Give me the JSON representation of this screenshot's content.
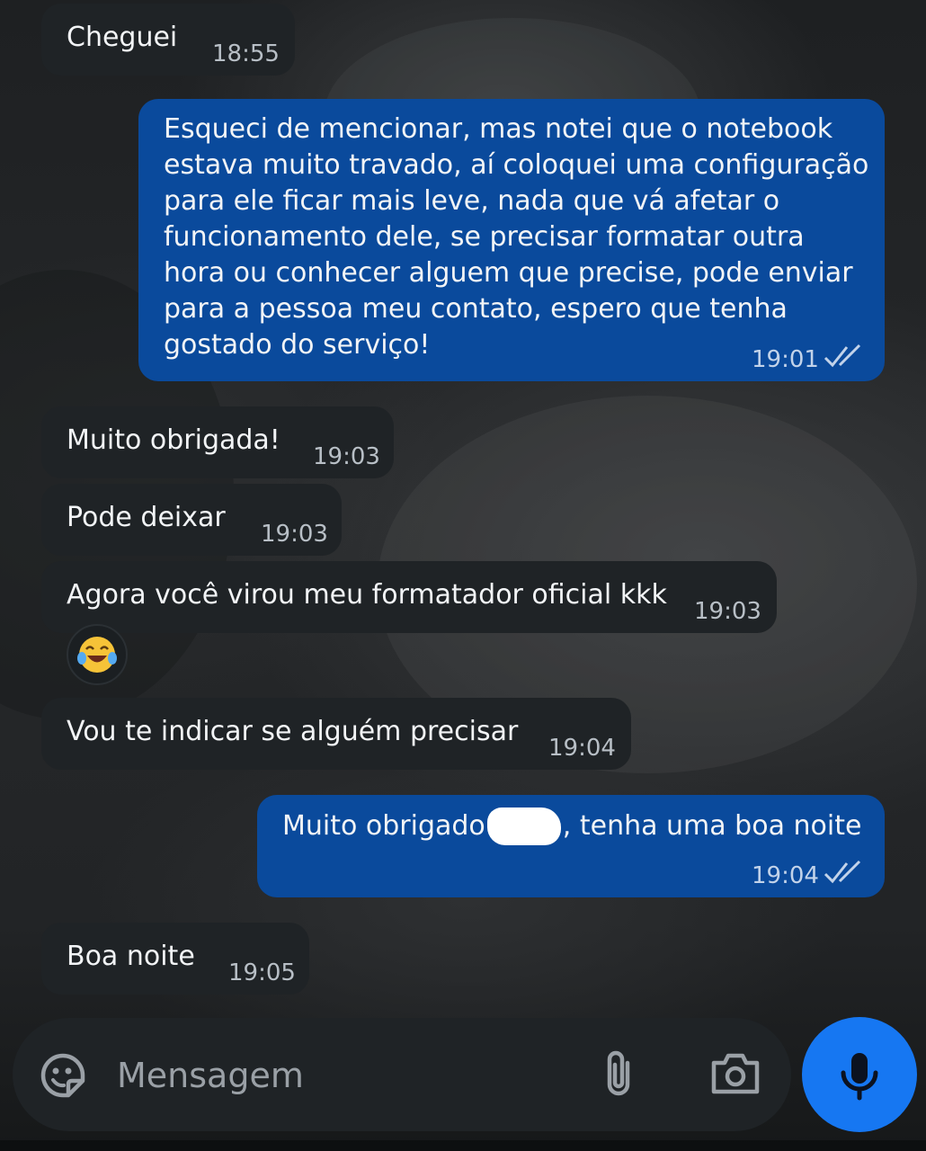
{
  "messages": [
    {
      "direction": "incoming",
      "text": "Cheguei",
      "time": "18:55"
    },
    {
      "direction": "outgoing",
      "text": "Esqueci de mencionar, mas notei que o notebook\nestava muito travado, aí coloquei uma configuração\npara ele ficar mais leve, nada que vá afetar o\nfuncionamento dele, se precisar formatar outra\nhora ou conhecer alguem que precise, pode enviar\npara a pessoa meu contato, espero que tenha\ngostado do serviço!",
      "time": "19:01",
      "status_icon": "double-check-icon"
    },
    {
      "direction": "incoming",
      "text": "Muito obrigada!",
      "time": "19:03"
    },
    {
      "direction": "incoming",
      "text": "Pode deixar",
      "time": "19:03"
    },
    {
      "direction": "incoming",
      "text": "Agora você virou meu formatador oficial kkk",
      "time": "19:03",
      "reaction": "😂"
    },
    {
      "direction": "incoming",
      "text": "Vou te indicar se alguém precisar",
      "time": "19:04"
    },
    {
      "direction": "outgoing",
      "text_before": "Muito obrigado",
      "text_after": ", tenha uma boa noite",
      "redacted": true,
      "time": "19:04",
      "status_icon": "double-check-icon"
    },
    {
      "direction": "incoming",
      "text": "Boa noite",
      "time": "19:05"
    }
  ],
  "composer": {
    "placeholder": "Mensagem",
    "icons": [
      "sticker-icon",
      "attach-icon",
      "camera-icon",
      "microphone-icon"
    ]
  },
  "colors": {
    "incoming_bubble": "#1f2326",
    "outgoing_bubble": "#0a4a9c",
    "mic_button": "#1677f2"
  }
}
